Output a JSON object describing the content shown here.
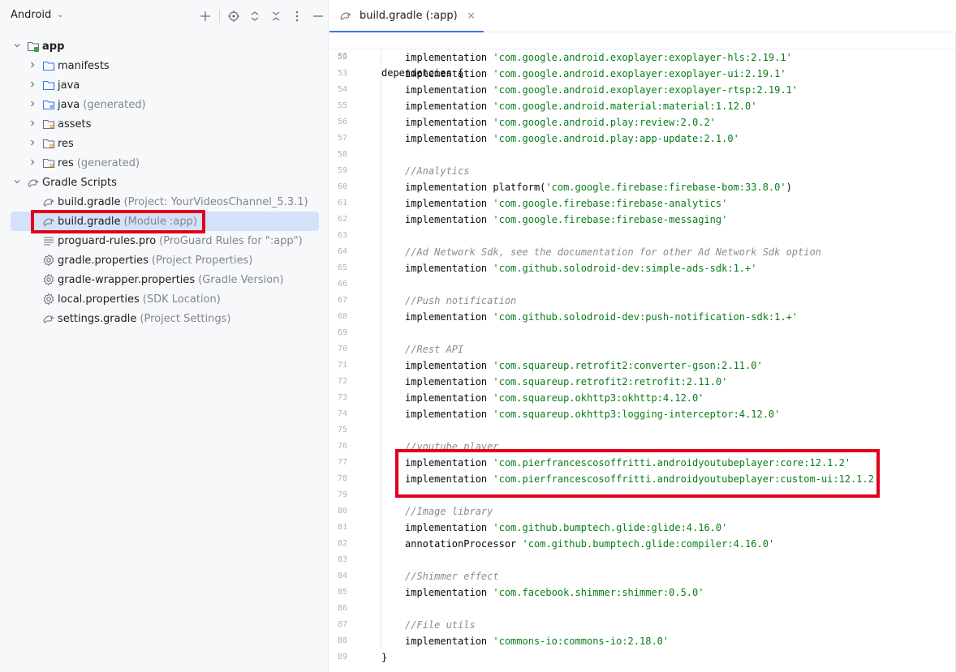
{
  "panel": {
    "view_selector": "Android",
    "header_icons": [
      "plus-icon",
      "locate-icon",
      "expand-all-icon",
      "collapse-all-icon",
      "more-icon",
      "minimize-icon"
    ]
  },
  "tree": [
    {
      "label": "app",
      "hint": "",
      "icon": "app-module-icon",
      "expand": "down",
      "level": 0,
      "bold": true
    },
    {
      "label": "manifests",
      "hint": "",
      "icon": "folder-icon",
      "expand": "right",
      "level": 1
    },
    {
      "label": "java",
      "hint": "",
      "icon": "folder-icon",
      "expand": "right",
      "level": 1
    },
    {
      "label": "java",
      "hint": "(generated)",
      "icon": "generated-folder-icon",
      "expand": "right",
      "level": 1
    },
    {
      "label": "assets",
      "hint": "",
      "icon": "resource-folder-icon",
      "expand": "right",
      "level": 1
    },
    {
      "label": "res",
      "hint": "",
      "icon": "resource-folder-icon",
      "expand": "right",
      "level": 1
    },
    {
      "label": "res",
      "hint": "(generated)",
      "icon": "resource-folder-icon",
      "expand": "right",
      "level": 1
    },
    {
      "label": "Gradle Scripts",
      "hint": "",
      "icon": "gradle-icon",
      "expand": "down",
      "level": 0
    },
    {
      "label": "build.gradle",
      "hint": "(Project: YourVideosChannel_5.3.1)",
      "icon": "gradle-icon",
      "expand": "",
      "level": 1
    },
    {
      "label": "build.gradle",
      "hint": "(Module :app)",
      "icon": "gradle-icon",
      "expand": "",
      "level": 1,
      "selected": true
    },
    {
      "label": "proguard-rules.pro",
      "hint": "(ProGuard Rules for \":app\")",
      "icon": "text-file-icon",
      "expand": "",
      "level": 1
    },
    {
      "label": "gradle.properties",
      "hint": "(Project Properties)",
      "icon": "settings-icon",
      "expand": "",
      "level": 1
    },
    {
      "label": "gradle-wrapper.properties",
      "hint": "(Gradle Version)",
      "icon": "settings-icon",
      "expand": "",
      "level": 1
    },
    {
      "label": "local.properties",
      "hint": "(SDK Location)",
      "icon": "settings-icon",
      "expand": "",
      "level": 1
    },
    {
      "label": "settings.gradle",
      "hint": "(Project Settings)",
      "icon": "gradle-icon",
      "expand": "",
      "level": 1
    }
  ],
  "editor": {
    "tab_label": "build.gradle (:app)",
    "tab_close": "×",
    "sticky": {
      "num": "36",
      "text": "dependencies {"
    },
    "lines": [
      {
        "num": "52",
        "kw": "implementation ",
        "str": "'com.google.android.exoplayer:exoplayer-hls:2.19.1'"
      },
      {
        "num": "53",
        "kw": "implementation ",
        "str": "'com.google.android.exoplayer:exoplayer-ui:2.19.1'"
      },
      {
        "num": "54",
        "kw": "implementation ",
        "str": "'com.google.android.exoplayer:exoplayer-rtsp:2.19.1'"
      },
      {
        "num": "55",
        "kw": "implementation ",
        "str": "'com.google.android.material:material:1.12.0'"
      },
      {
        "num": "56",
        "kw": "implementation ",
        "str": "'com.google.android.play:review:2.0.2'"
      },
      {
        "num": "57",
        "kw": "implementation ",
        "str": "'com.google.android.play:app-update:2.1.0'"
      },
      {
        "num": "58"
      },
      {
        "num": "59",
        "cmt": "//Analytics"
      },
      {
        "num": "60",
        "kw": "implementation platform(",
        "str": "'com.google.firebase:firebase-bom:33.8.0'",
        "tail": ")"
      },
      {
        "num": "61",
        "kw": "implementation ",
        "str": "'com.google.firebase:firebase-analytics'"
      },
      {
        "num": "62",
        "kw": "implementation ",
        "str": "'com.google.firebase:firebase-messaging'"
      },
      {
        "num": "63"
      },
      {
        "num": "64",
        "cmt": "//Ad Network Sdk, see the documentation for other Ad Network Sdk option"
      },
      {
        "num": "65",
        "kw": "implementation ",
        "str": "'com.github.solodroid-dev:simple-ads-sdk:1.+'"
      },
      {
        "num": "66"
      },
      {
        "num": "67",
        "cmt": "//Push notification"
      },
      {
        "num": "68",
        "kw": "implementation ",
        "str": "'com.github.solodroid-dev:push-notification-sdk:1.+'"
      },
      {
        "num": "69"
      },
      {
        "num": "70",
        "cmt": "//Rest API"
      },
      {
        "num": "71",
        "kw": "implementation ",
        "str": "'com.squareup.retrofit2:converter-gson:2.11.0'"
      },
      {
        "num": "72",
        "kw": "implementation ",
        "str": "'com.squareup.retrofit2:retrofit:2.11.0'"
      },
      {
        "num": "73",
        "kw": "implementation ",
        "str": "'com.squareup.okhttp3:okhttp:4.12.0'"
      },
      {
        "num": "74",
        "kw": "implementation ",
        "str": "'com.squareup.okhttp3:logging-interceptor:4.12.0'"
      },
      {
        "num": "75"
      },
      {
        "num": "76",
        "cmt": "//youtube player"
      },
      {
        "num": "77",
        "kw": "implementation ",
        "str": "'com.pierfrancescosoffritti.androidyoutubeplayer:core:12.1.2'"
      },
      {
        "num": "78",
        "kw": "implementation ",
        "str": "'com.pierfrancescosoffritti.androidyoutubeplayer:custom-ui:12.1.2'"
      },
      {
        "num": "79"
      },
      {
        "num": "80",
        "cmt": "//Image library"
      },
      {
        "num": "81",
        "kw": "implementation ",
        "str": "'com.github.bumptech.glide:glide:4.16.0'"
      },
      {
        "num": "82",
        "kw": "annotationProcessor ",
        "str": "'com.github.bumptech.glide:compiler:4.16.0'"
      },
      {
        "num": "83"
      },
      {
        "num": "84",
        "cmt": "//Shimmer effect"
      },
      {
        "num": "85",
        "kw": "implementation ",
        "str": "'com.facebook.shimmer:shimmer:0.5.0'"
      },
      {
        "num": "86"
      },
      {
        "num": "87",
        "cmt": "//File utils"
      },
      {
        "num": "88",
        "kw": "implementation ",
        "str": "'commons-io:commons-io:2.18.0'"
      },
      {
        "num": "89",
        "closing": "}"
      }
    ]
  },
  "colors": {
    "highlight_border": "#e0001b",
    "selection": "#d5e1f9",
    "string": "#067d17",
    "comment": "#8c8c8c"
  }
}
